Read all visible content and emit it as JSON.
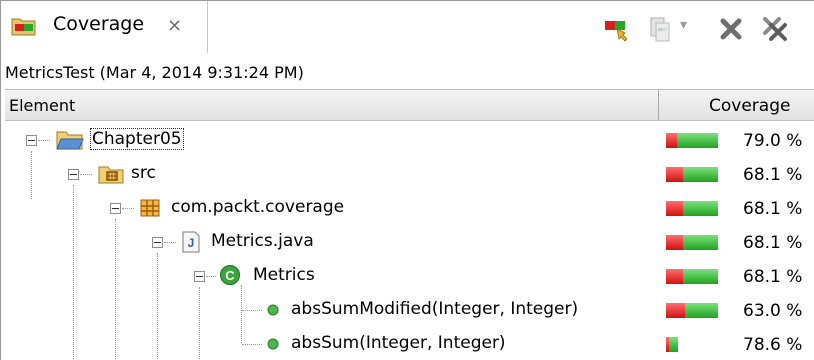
{
  "view": {
    "tab_title": "Coverage",
    "close_glyph": "⨯",
    "session_label": "MetricsTest (Mar 4, 2014 9:31:24 PM)",
    "toolbar": {
      "icons": [
        "coverage-launch-icon",
        "merge-sessions-icon",
        "dropdown-arrow-icon",
        "remove-session-icon",
        "remove-all-sessions-icon"
      ],
      "dropdown_glyph": "▾"
    }
  },
  "columns": {
    "element": "Element",
    "coverage": "Coverage"
  },
  "rows": [
    {
      "label": "Chapter05",
      "icon": "project-folder-icon",
      "coverage": "79.0 %",
      "coverage_value": 79.0,
      "focused": true
    },
    {
      "label": "src",
      "icon": "source-folder-icon",
      "coverage": "68.1 %",
      "coverage_value": 68.1
    },
    {
      "label": "com.packt.coverage",
      "icon": "package-icon",
      "coverage": "68.1 %",
      "coverage_value": 68.1
    },
    {
      "label": "Metrics.java",
      "icon": "java-file-icon",
      "coverage": "68.1 %",
      "coverage_value": 68.1
    },
    {
      "label": "Metrics",
      "icon": "class-icon",
      "coverage": "68.1 %",
      "coverage_value": 68.1
    },
    {
      "label": "absSumModified(Integer, Integer)",
      "icon": "public-method-icon",
      "coverage": "63.0 %",
      "coverage_value": 63.0
    },
    {
      "label": "absSum(Integer, Integer)",
      "icon": "public-method-icon",
      "coverage": "78.6 %",
      "coverage_value": 78.6
    }
  ],
  "colors": {
    "covered": "#2eb82e",
    "missed": "#e01b1b",
    "tree_lines": "#9a9a9a"
  }
}
